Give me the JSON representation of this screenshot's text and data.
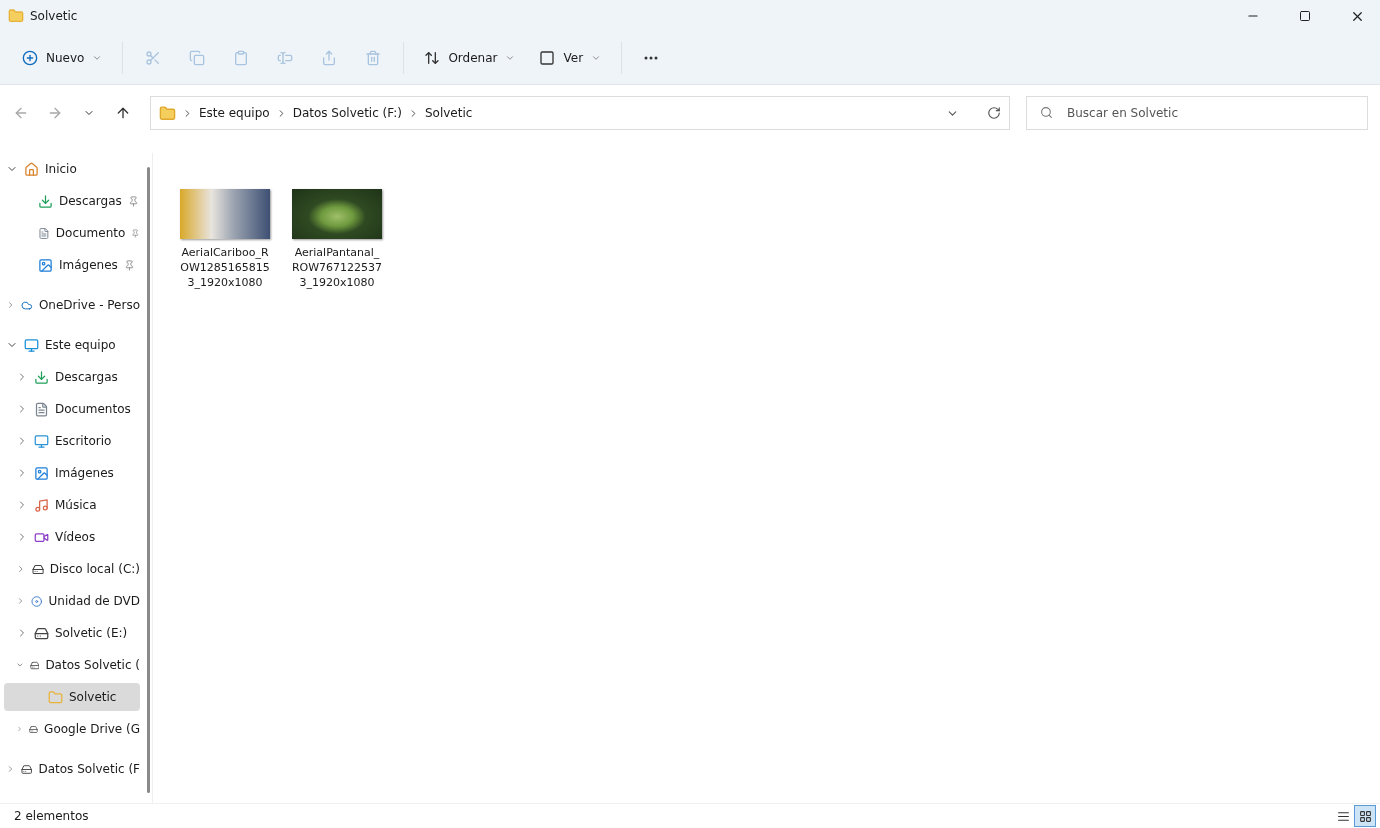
{
  "window": {
    "title": "Solvetic"
  },
  "toolbar": [
    {
      "kind": "new",
      "label": "Nuevo",
      "disabled": false
    },
    {
      "kind": "separator"
    },
    {
      "kind": "cut",
      "disabled": true
    },
    {
      "kind": "copy",
      "disabled": true
    },
    {
      "kind": "paste",
      "disabled": true
    },
    {
      "kind": "rename",
      "disabled": true
    },
    {
      "kind": "share",
      "disabled": true
    },
    {
      "kind": "delete",
      "disabled": true
    },
    {
      "kind": "separator"
    },
    {
      "kind": "sort",
      "label": "Ordenar",
      "disabled": false
    },
    {
      "kind": "view",
      "label": "Ver",
      "disabled": false
    },
    {
      "kind": "separator"
    },
    {
      "kind": "more",
      "disabled": false
    }
  ],
  "navigation": [
    {
      "kind": "back",
      "disabled": true
    },
    {
      "kind": "forward",
      "disabled": true
    },
    {
      "kind": "recent",
      "disabled": false
    },
    {
      "kind": "up",
      "disabled": false
    }
  ],
  "address_bar": {
    "breadcrumbs": [
      "Este equipo",
      "Datos Solvetic (F:)",
      "Solvetic"
    ]
  },
  "search": {
    "placeholder": "Buscar en Solvetic"
  },
  "sidebar": {
    "items": [
      {
        "kind": "home",
        "label": "Inicio",
        "expanded": true,
        "selected": false,
        "children": [
          {
            "kind": "download",
            "label": "Descargas",
            "pinned": true,
            "selected": false
          },
          {
            "kind": "document",
            "label": "Documento",
            "pinned": true,
            "selected": false
          },
          {
            "kind": "pictures",
            "label": "Imágenes",
            "pinned": true,
            "selected": false
          }
        ]
      },
      {
        "kind": "cloud",
        "label": "OneDrive - Perso",
        "expanded": false,
        "selected": false
      },
      {
        "kind": "pc",
        "label": "Este equipo",
        "expanded": true,
        "selected": false,
        "children": [
          {
            "kind": "download",
            "label": "Descargas",
            "expanded": false,
            "selected": false
          },
          {
            "kind": "document",
            "label": "Documentos",
            "expanded": false,
            "selected": false
          },
          {
            "kind": "desktop",
            "label": "Escritorio",
            "expanded": false,
            "selected": false
          },
          {
            "kind": "pictures",
            "label": "Imágenes",
            "expanded": false,
            "selected": false
          },
          {
            "kind": "music",
            "label": "Música",
            "expanded": false,
            "selected": false
          },
          {
            "kind": "video",
            "label": "Vídeos",
            "expanded": false,
            "selected": false
          },
          {
            "kind": "disk",
            "label": "Disco local (C:)",
            "expanded": false,
            "selected": false
          },
          {
            "kind": "dvd",
            "label": "Unidad de DVD",
            "expanded": false,
            "selected": false
          },
          {
            "kind": "drive",
            "label": "Solvetic (E:)",
            "expanded": false,
            "selected": false
          },
          {
            "kind": "drive",
            "label": "Datos Solvetic (",
            "expanded": true,
            "selected": false,
            "children": [
              {
                "kind": "folder",
                "label": "Solvetic",
                "selected": true
              }
            ]
          },
          {
            "kind": "drive",
            "label": "Google Drive (G",
            "expanded": false,
            "selected": false
          }
        ]
      },
      {
        "kind": "drive",
        "label": "Datos Solvetic (F",
        "expanded": false,
        "selected": false
      }
    ]
  },
  "files": [
    {
      "name": "AerialCariboo_ROW12851658153_1920x1080"
    },
    {
      "name": "AerialPantanal_ROW7671225373_1920x1080"
    }
  ],
  "status_bar": {
    "count": "2 elementos",
    "views": [
      {
        "kind": "details",
        "selected": false
      },
      {
        "kind": "tiles",
        "selected": true
      }
    ]
  }
}
